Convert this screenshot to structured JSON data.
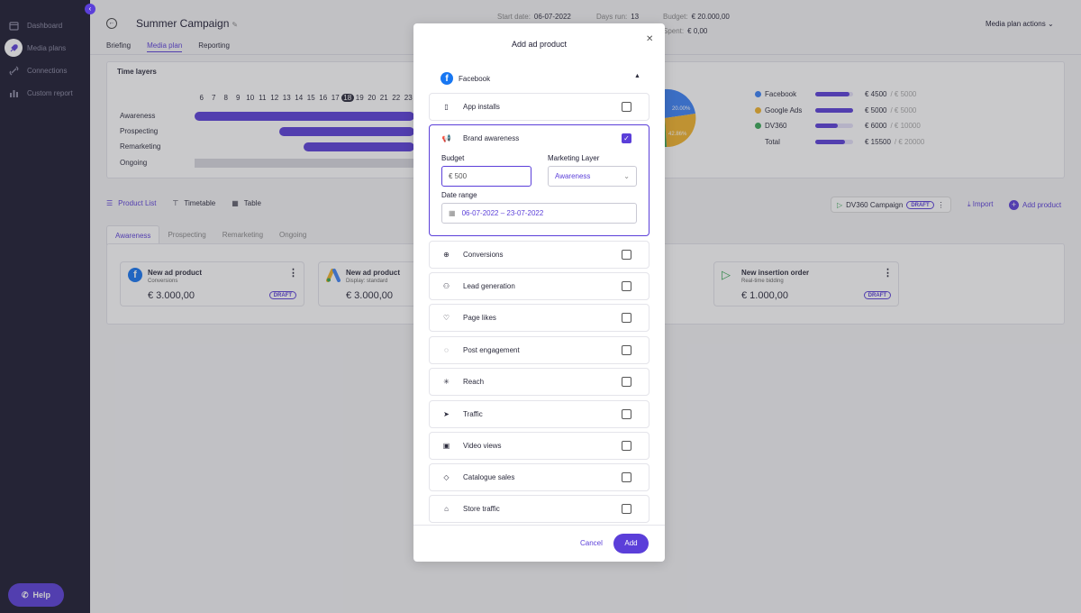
{
  "sidebar": {
    "items": [
      {
        "label": "Dashboard",
        "icon": "calendar-icon"
      },
      {
        "label": "Media plans",
        "icon": "rocket-icon"
      },
      {
        "label": "Connections",
        "icon": "link-icon"
      },
      {
        "label": "Custom report",
        "icon": "bar-chart-icon"
      }
    ],
    "help": "Help"
  },
  "header": {
    "title": "Summer Campaign",
    "start_date_label": "Start date:",
    "start_date": "06-07-2022",
    "days_run_label": "Days run:",
    "days_run": "13",
    "budget_label": "Budget:",
    "budget": "€ 20.000,00",
    "spent_label": "Spent:",
    "spent": "€ 0,00",
    "actions": "Media plan actions"
  },
  "tabs": [
    "Briefing",
    "Media plan",
    "Reporting"
  ],
  "time_layers": {
    "title": "Time layers",
    "days": [
      "6",
      "7",
      "8",
      "9",
      "10",
      "11",
      "12",
      "13",
      "14",
      "15",
      "16",
      "17",
      "18",
      "19",
      "20",
      "21",
      "22",
      "23"
    ],
    "today": "18",
    "rows": [
      "Awareness",
      "Prospecting",
      "Remarketing",
      "Ongoing"
    ]
  },
  "pie_labels": [
    "20.00%",
    "42.86%"
  ],
  "legend": [
    {
      "name": "Facebook",
      "value": "€ 4500",
      "total": "/ € 5000",
      "color": "#3b82f6",
      "fraction": 0.9
    },
    {
      "name": "Google Ads",
      "value": "€ 5000",
      "total": "/ € 5000",
      "color": "#f2b32c",
      "fraction": 1.0
    },
    {
      "name": "DV360",
      "value": "€ 6000",
      "total": "/ € 10000",
      "color": "#3aa856",
      "fraction": 0.6
    },
    {
      "name": "Total",
      "value": "€ 15500",
      "total": "/ € 20000",
      "color": "",
      "fraction": 0.775
    }
  ],
  "view_tabs": [
    "Product List",
    "Timetable",
    "Table"
  ],
  "dv360_chip": "DV360 Campaign",
  "draft": "DRAFT",
  "import": "Import",
  "add_product": "Add product",
  "layer_tabs": [
    "Awareness",
    "Prospecting",
    "Remarketing",
    "Ongoing"
  ],
  "products": [
    {
      "title": "New ad product",
      "sub": "Conversions",
      "price": "€ 3.000,00"
    },
    {
      "title": "New ad product",
      "sub": "Display: standard",
      "price": "€ 3.000,00"
    },
    {
      "title": "New insertion order",
      "sub": "Real-time bidding",
      "price": "€ 1.000,00"
    }
  ],
  "modal": {
    "title": "Add ad product",
    "platform": "Facebook",
    "options": [
      {
        "label": "App installs",
        "icon": "phone-download-icon",
        "checked": false
      },
      {
        "label": "Brand awareness",
        "icon": "megaphone-icon",
        "checked": true
      },
      {
        "label": "Conversions",
        "icon": "globe-icon",
        "checked": false
      },
      {
        "label": "Lead generation",
        "icon": "add-user-icon",
        "checked": false
      },
      {
        "label": "Page likes",
        "icon": "heart-icon",
        "checked": false
      },
      {
        "label": "Post engagement",
        "icon": "chat-bubble-icon",
        "checked": false
      },
      {
        "label": "Reach",
        "icon": "reach-icon",
        "checked": false
      },
      {
        "label": "Traffic",
        "icon": "cursor-icon",
        "checked": false
      },
      {
        "label": "Video views",
        "icon": "video-camera-icon",
        "checked": false
      },
      {
        "label": "Catalogue sales",
        "icon": "tag-icon",
        "checked": false
      },
      {
        "label": "Store traffic",
        "icon": "store-icon",
        "checked": false
      }
    ],
    "budget_label": "Budget",
    "budget_value": "€ 500",
    "layer_label": "Marketing Layer",
    "layer_value": "Awareness",
    "date_label": "Date range",
    "date_value": "06-07-2022 – 23-07-2022",
    "cancel": "Cancel",
    "add": "Add"
  },
  "colors": {
    "accent": "#5b3fd9",
    "sidebar": "#1c1b31"
  }
}
